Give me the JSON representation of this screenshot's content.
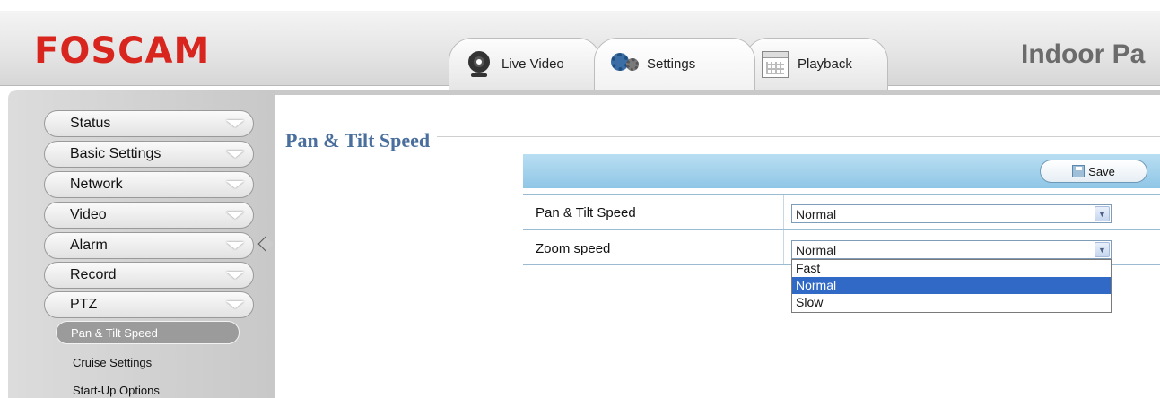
{
  "header": {
    "logo": "FOSCAM",
    "page_heading": "Indoor Pa"
  },
  "tabs": [
    {
      "label": "Live Video",
      "icon": "webcam-icon"
    },
    {
      "label": "Settings",
      "icon": "gear-icon"
    },
    {
      "label": "Playback",
      "icon": "calendar-icon"
    }
  ],
  "sidebar": {
    "items": [
      {
        "label": "Status"
      },
      {
        "label": "Basic Settings"
      },
      {
        "label": "Network"
      },
      {
        "label": "Video"
      },
      {
        "label": "Alarm"
      },
      {
        "label": "Record"
      },
      {
        "label": "PTZ"
      }
    ],
    "sub_items": [
      {
        "label": "Pan & Tilt Speed",
        "active": true
      },
      {
        "label": "Cruise Settings"
      },
      {
        "label": "Start-Up Options"
      }
    ]
  },
  "main": {
    "section_title": "Pan & Tilt Speed",
    "save_label": "Save",
    "rows": [
      {
        "label": "Pan & Tilt Speed",
        "value": "Normal"
      },
      {
        "label": "Zoom speed",
        "value": "Normal"
      }
    ],
    "dropdown_options": [
      {
        "label": "Fast"
      },
      {
        "label": "Normal",
        "selected": true
      },
      {
        "label": "Slow"
      }
    ]
  },
  "colors": {
    "logo_red": "#d8261f",
    "title_blue": "#4a6f9c",
    "header_band": "#a6d3ec",
    "option_highlight": "#3169c6"
  }
}
